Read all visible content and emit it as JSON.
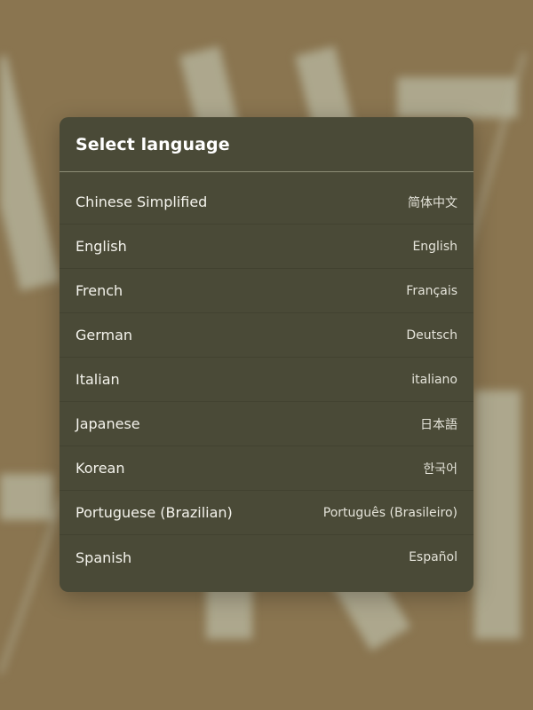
{
  "dialog": {
    "title": "Select language",
    "languages": [
      {
        "name": "Chinese Simplified",
        "native": "简体中文"
      },
      {
        "name": "English",
        "native": "English"
      },
      {
        "name": "French",
        "native": "Français"
      },
      {
        "name": "German",
        "native": "Deutsch"
      },
      {
        "name": "Italian",
        "native": "italiano"
      },
      {
        "name": "Japanese",
        "native": "日本語"
      },
      {
        "name": "Korean",
        "native": "한국어"
      },
      {
        "name": "Portuguese (Brazilian)",
        "native": "Português (Brasileiro)"
      },
      {
        "name": "Spanish",
        "native": "Español"
      }
    ]
  },
  "colors": {
    "backdrop": "#8a7550",
    "dialog_background": "#4a4a37",
    "header_divider": "#8d8d76",
    "text_primary": "#ffffff"
  }
}
